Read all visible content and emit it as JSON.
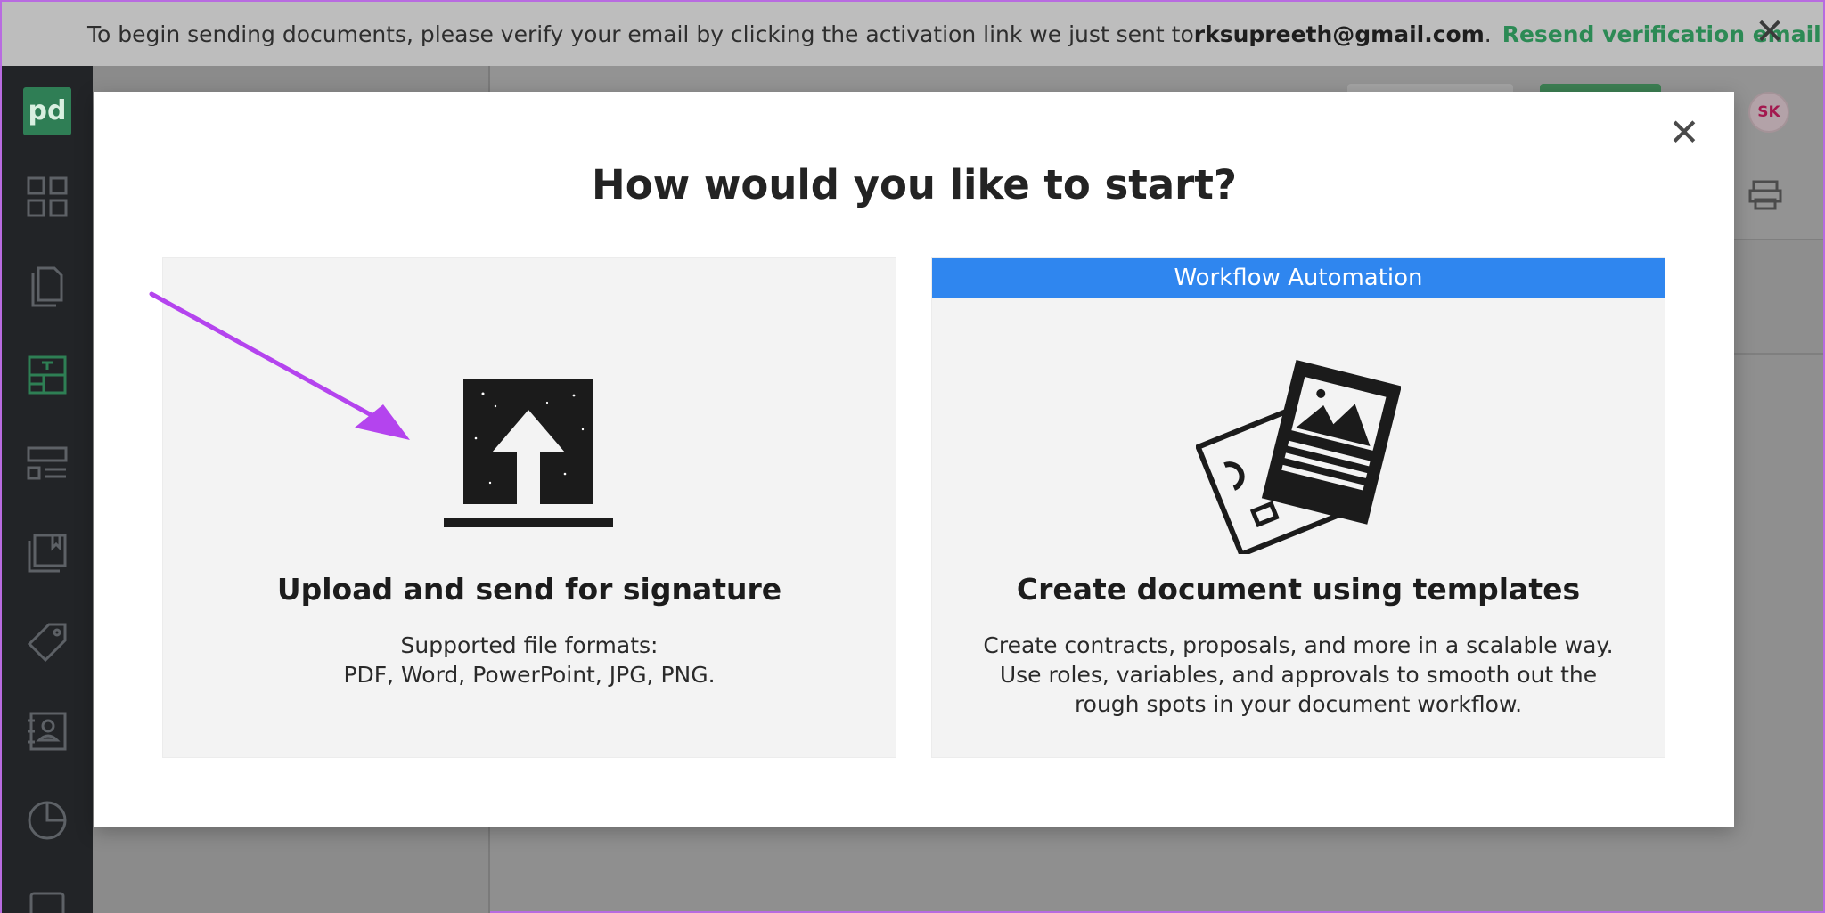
{
  "banner": {
    "message": "To begin sending documents, please verify your email by clicking the activation link we just sent to ",
    "email": "rksupreeth@gmail.com",
    "period": ".",
    "resend_label": "Resend verification email",
    "close_glyph": "✕"
  },
  "sidebar": {
    "logo_text": "pd",
    "icons": [
      "dashboard-icon",
      "documents-icon",
      "templates-icon",
      "forms-icon",
      "content-library-icon",
      "catalog-icon",
      "contacts-icon",
      "reports-icon",
      "more-icon"
    ]
  },
  "header": {
    "avatar_initials": "SK"
  },
  "modal": {
    "close_glyph": "✕",
    "title": "How would you like to start?",
    "upload_card": {
      "heading": "Upload and send for signature",
      "desc_line1": "Supported file formats:",
      "desc_line2": "PDF, Word, PowerPoint, JPG, PNG."
    },
    "template_card": {
      "ribbon": "Workflow Automation",
      "heading": "Create document using templates",
      "desc_line1": "Create contracts, proposals, and more in a scalable way.",
      "desc_line2": "Use roles, variables, and approvals to smooth out the",
      "desc_line3": "rough spots in your document workflow."
    }
  },
  "colors": {
    "accent_blue": "#2f86ef",
    "brand_green": "#2c8a55",
    "annotation_arrow": "#b444ee"
  }
}
